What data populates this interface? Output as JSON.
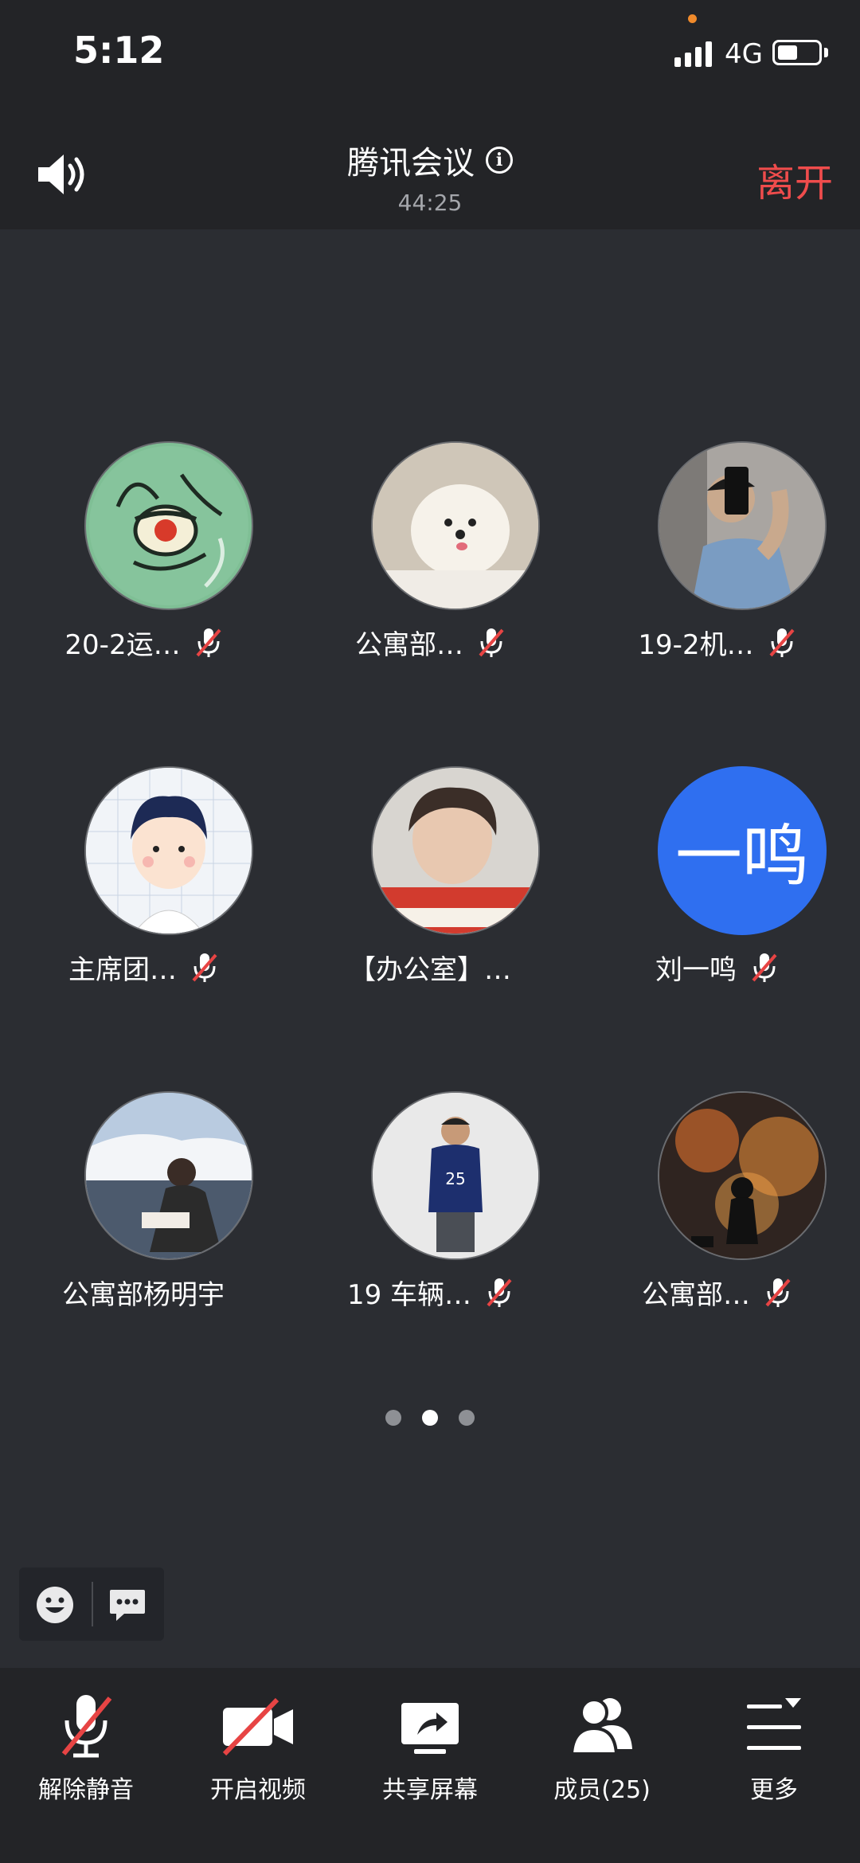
{
  "status_bar": {
    "time": "5:12",
    "network": "4G"
  },
  "header": {
    "title": "腾讯会议",
    "timer": "44:25",
    "leave_label": "离开"
  },
  "participants": [
    {
      "name": "20-2运…",
      "muted": true
    },
    {
      "name": "公寓部…",
      "muted": true
    },
    {
      "name": "19-2机…",
      "muted": true
    },
    {
      "name": "主席团…",
      "muted": true
    },
    {
      "name": "【办公室】…",
      "muted": false
    },
    {
      "name": "刘一鸣",
      "muted": true,
      "avatar_text": "一鸣"
    },
    {
      "name": "公寓部杨明宇",
      "muted": false
    },
    {
      "name": "19 车辆…",
      "muted": true
    },
    {
      "name": "公寓部…",
      "muted": true
    }
  ],
  "pagination": {
    "pages": 3,
    "current": 2
  },
  "toolbar": [
    {
      "label": "解除静音",
      "icon": "mic-muted-icon"
    },
    {
      "label": "开启视频",
      "icon": "video-off-icon"
    },
    {
      "label": "共享屏幕",
      "icon": "share-screen-icon"
    },
    {
      "label": "成员(25)",
      "icon": "members-icon"
    },
    {
      "label": "更多",
      "icon": "more-icon"
    }
  ],
  "colors": {
    "accent_red": "#ef4c4c",
    "avatar_blue": "#2f6ff0",
    "background": "#2b2d32"
  }
}
